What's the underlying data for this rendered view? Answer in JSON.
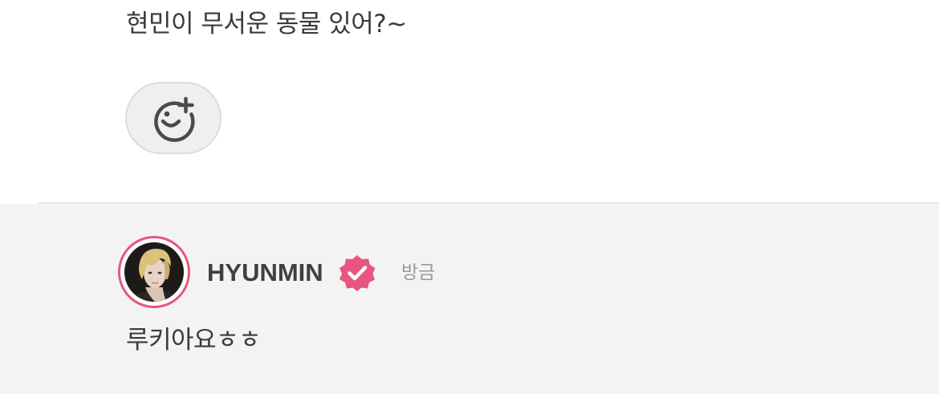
{
  "post": {
    "text": "현민이 무서운 동물 있어?~",
    "reaction_icon": "smiley-plus-icon"
  },
  "comment": {
    "author": "HYUNMIN",
    "verified_icon": "verified-check-icon",
    "timestamp": "방금",
    "text": "루키아요ㅎㅎ",
    "accent_color": "#e65680"
  }
}
